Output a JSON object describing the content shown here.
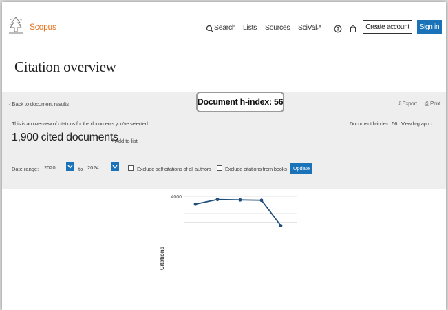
{
  "header": {
    "brand": "Scopus",
    "nav": [
      "Search",
      "Lists",
      "Sources",
      "SciVal"
    ],
    "nav_suffix": "↗",
    "create_account": "Create account",
    "sign_in": "Sign in"
  },
  "page": {
    "title": "Citation overview",
    "back_link": "Back to document results",
    "hindex_callout": "Document h-index: 56",
    "export": "Export",
    "print": "Print",
    "overview_text": "This is an overview of citations for the documents you've selected.",
    "hindex_small": "Document h-index : 56",
    "view_graph": "View h-graph",
    "cited_documents": "1,900 cited documents",
    "add_to_list": "Add to list"
  },
  "filters": {
    "date_range_label": "Date range:",
    "from_year": "2020",
    "to_label": "to",
    "to_year": "2024",
    "exclude_self": "Exclude self citations of all authors",
    "exclude_books": "Exclude citations from books",
    "update": "Update"
  },
  "colors": {
    "brand_orange": "#e9711c",
    "accent_blue": "#1a73b8",
    "line": "#1f4e79"
  },
  "chart_data": {
    "type": "line",
    "ylabel": "Citations",
    "yticks": [
      "4000"
    ],
    "grid": true,
    "series": [
      {
        "values": [
          3100,
          3630,
          3580,
          3540,
          600
        ]
      }
    ]
  }
}
